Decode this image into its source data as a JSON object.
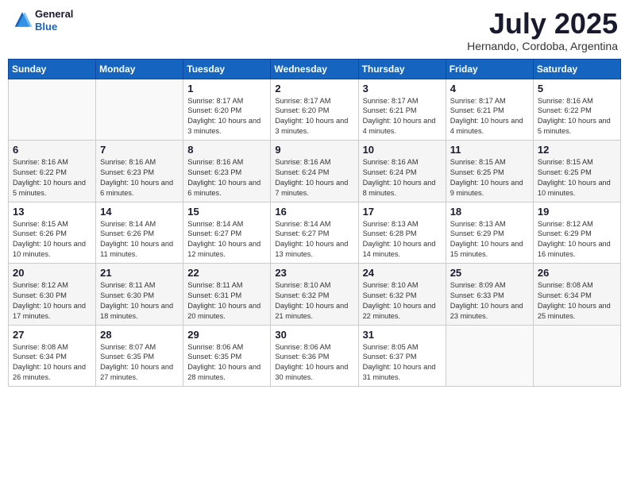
{
  "header": {
    "logo": {
      "line1": "General",
      "line2": "Blue"
    },
    "month_year": "July 2025",
    "location": "Hernando, Cordoba, Argentina"
  },
  "weekdays": [
    "Sunday",
    "Monday",
    "Tuesday",
    "Wednesday",
    "Thursday",
    "Friday",
    "Saturday"
  ],
  "weeks": [
    [
      {
        "day": "",
        "info": ""
      },
      {
        "day": "",
        "info": ""
      },
      {
        "day": "1",
        "info": "Sunrise: 8:17 AM\nSunset: 6:20 PM\nDaylight: 10 hours and 3 minutes."
      },
      {
        "day": "2",
        "info": "Sunrise: 8:17 AM\nSunset: 6:20 PM\nDaylight: 10 hours and 3 minutes."
      },
      {
        "day": "3",
        "info": "Sunrise: 8:17 AM\nSunset: 6:21 PM\nDaylight: 10 hours and 4 minutes."
      },
      {
        "day": "4",
        "info": "Sunrise: 8:17 AM\nSunset: 6:21 PM\nDaylight: 10 hours and 4 minutes."
      },
      {
        "day": "5",
        "info": "Sunrise: 8:16 AM\nSunset: 6:22 PM\nDaylight: 10 hours and 5 minutes."
      }
    ],
    [
      {
        "day": "6",
        "info": "Sunrise: 8:16 AM\nSunset: 6:22 PM\nDaylight: 10 hours and 5 minutes."
      },
      {
        "day": "7",
        "info": "Sunrise: 8:16 AM\nSunset: 6:23 PM\nDaylight: 10 hours and 6 minutes."
      },
      {
        "day": "8",
        "info": "Sunrise: 8:16 AM\nSunset: 6:23 PM\nDaylight: 10 hours and 6 minutes."
      },
      {
        "day": "9",
        "info": "Sunrise: 8:16 AM\nSunset: 6:24 PM\nDaylight: 10 hours and 7 minutes."
      },
      {
        "day": "10",
        "info": "Sunrise: 8:16 AM\nSunset: 6:24 PM\nDaylight: 10 hours and 8 minutes."
      },
      {
        "day": "11",
        "info": "Sunrise: 8:15 AM\nSunset: 6:25 PM\nDaylight: 10 hours and 9 minutes."
      },
      {
        "day": "12",
        "info": "Sunrise: 8:15 AM\nSunset: 6:25 PM\nDaylight: 10 hours and 10 minutes."
      }
    ],
    [
      {
        "day": "13",
        "info": "Sunrise: 8:15 AM\nSunset: 6:26 PM\nDaylight: 10 hours and 10 minutes."
      },
      {
        "day": "14",
        "info": "Sunrise: 8:14 AM\nSunset: 6:26 PM\nDaylight: 10 hours and 11 minutes."
      },
      {
        "day": "15",
        "info": "Sunrise: 8:14 AM\nSunset: 6:27 PM\nDaylight: 10 hours and 12 minutes."
      },
      {
        "day": "16",
        "info": "Sunrise: 8:14 AM\nSunset: 6:27 PM\nDaylight: 10 hours and 13 minutes."
      },
      {
        "day": "17",
        "info": "Sunrise: 8:13 AM\nSunset: 6:28 PM\nDaylight: 10 hours and 14 minutes."
      },
      {
        "day": "18",
        "info": "Sunrise: 8:13 AM\nSunset: 6:29 PM\nDaylight: 10 hours and 15 minutes."
      },
      {
        "day": "19",
        "info": "Sunrise: 8:12 AM\nSunset: 6:29 PM\nDaylight: 10 hours and 16 minutes."
      }
    ],
    [
      {
        "day": "20",
        "info": "Sunrise: 8:12 AM\nSunset: 6:30 PM\nDaylight: 10 hours and 17 minutes."
      },
      {
        "day": "21",
        "info": "Sunrise: 8:11 AM\nSunset: 6:30 PM\nDaylight: 10 hours and 18 minutes."
      },
      {
        "day": "22",
        "info": "Sunrise: 8:11 AM\nSunset: 6:31 PM\nDaylight: 10 hours and 20 minutes."
      },
      {
        "day": "23",
        "info": "Sunrise: 8:10 AM\nSunset: 6:32 PM\nDaylight: 10 hours and 21 minutes."
      },
      {
        "day": "24",
        "info": "Sunrise: 8:10 AM\nSunset: 6:32 PM\nDaylight: 10 hours and 22 minutes."
      },
      {
        "day": "25",
        "info": "Sunrise: 8:09 AM\nSunset: 6:33 PM\nDaylight: 10 hours and 23 minutes."
      },
      {
        "day": "26",
        "info": "Sunrise: 8:08 AM\nSunset: 6:34 PM\nDaylight: 10 hours and 25 minutes."
      }
    ],
    [
      {
        "day": "27",
        "info": "Sunrise: 8:08 AM\nSunset: 6:34 PM\nDaylight: 10 hours and 26 minutes."
      },
      {
        "day": "28",
        "info": "Sunrise: 8:07 AM\nSunset: 6:35 PM\nDaylight: 10 hours and 27 minutes."
      },
      {
        "day": "29",
        "info": "Sunrise: 8:06 AM\nSunset: 6:35 PM\nDaylight: 10 hours and 28 minutes."
      },
      {
        "day": "30",
        "info": "Sunrise: 8:06 AM\nSunset: 6:36 PM\nDaylight: 10 hours and 30 minutes."
      },
      {
        "day": "31",
        "info": "Sunrise: 8:05 AM\nSunset: 6:37 PM\nDaylight: 10 hours and 31 minutes."
      },
      {
        "day": "",
        "info": ""
      },
      {
        "day": "",
        "info": ""
      }
    ]
  ]
}
